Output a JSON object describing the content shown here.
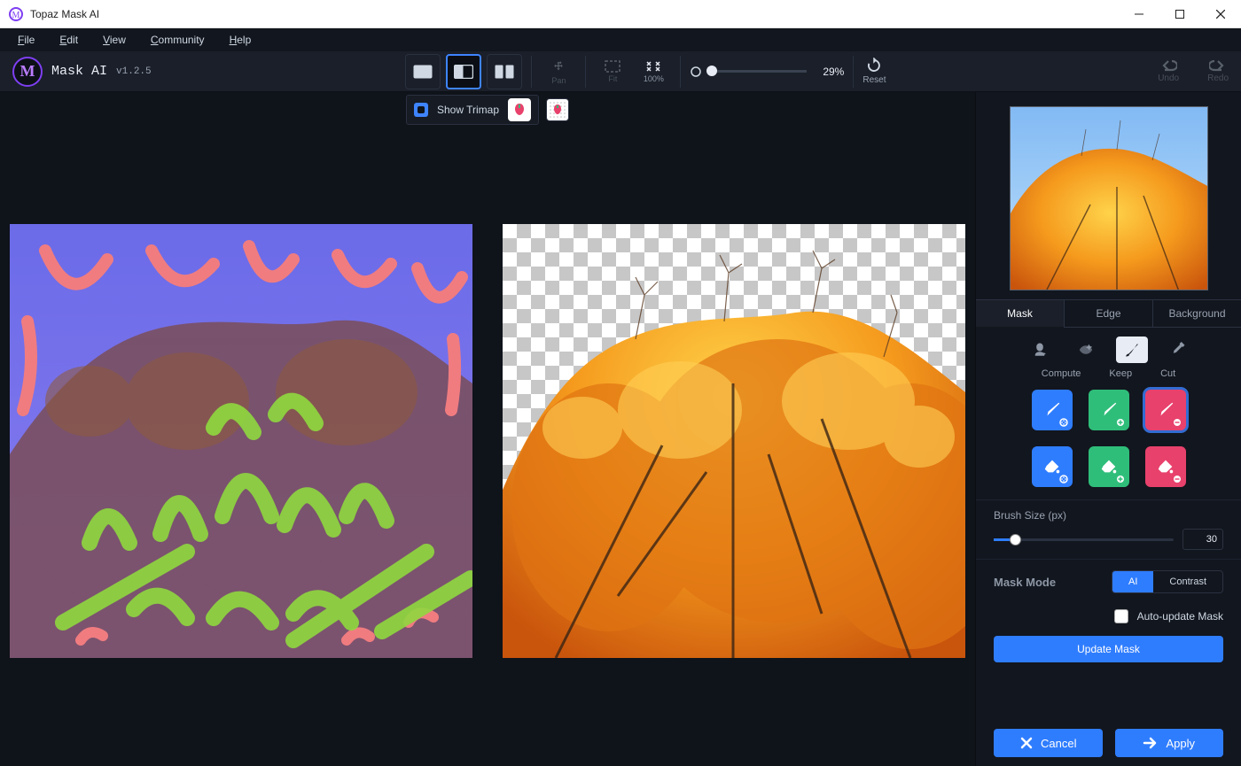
{
  "window": {
    "title": "Topaz Mask AI"
  },
  "menus": {
    "file": "File",
    "edit": "Edit",
    "view": "View",
    "community": "Community",
    "help": "Help"
  },
  "brand": {
    "name": "Mask AI",
    "version": "v1.2.5"
  },
  "toolbar": {
    "pan": "Pan",
    "fit": "Fit",
    "hundred": "100%",
    "zoom": "29%",
    "reset": "Reset",
    "undo": "Undo",
    "redo": "Redo"
  },
  "trimap": {
    "show": "Show Trimap"
  },
  "sidebar": {
    "tabs": {
      "mask": "Mask",
      "edge": "Edge",
      "background": "Background"
    },
    "labels": {
      "compute": "Compute",
      "keep": "Keep",
      "cut": "Cut"
    },
    "brush": {
      "title": "Brush Size (px)",
      "value": "30"
    },
    "mode": {
      "title": "Mask Mode",
      "ai": "AI",
      "contrast": "Contrast"
    },
    "auto": "Auto-update Mask",
    "update": "Update Mask",
    "cancel": "Cancel",
    "apply": "Apply"
  }
}
